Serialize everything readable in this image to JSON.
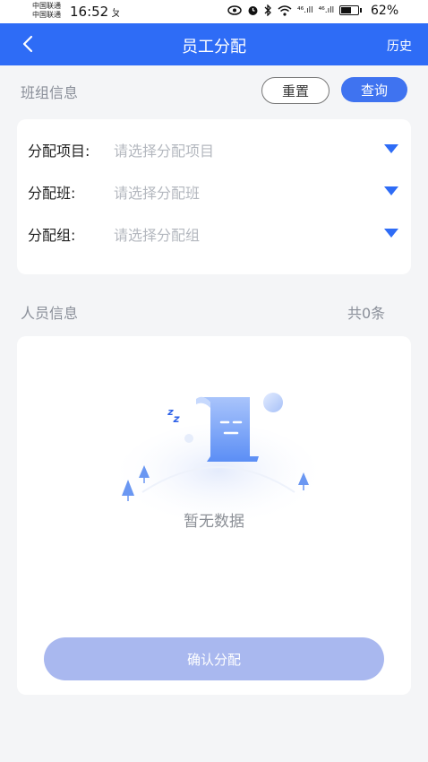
{
  "status_bar": {
    "carrier_1": "中国联通",
    "carrier_2": "中国联通",
    "time": "16:52",
    "notification_glyph": "ㄆ",
    "signal_1": "⁴⁶.ıll",
    "signal_2": "⁴⁶.ıll",
    "battery_level": 0.62,
    "battery_text": "62%"
  },
  "header": {
    "title": "员工分配",
    "history_label": "历史"
  },
  "team_section": {
    "label": "班组信息",
    "reset_label": "重置",
    "query_label": "查询"
  },
  "form": {
    "rows": [
      {
        "label": "分配项目:",
        "placeholder": "请选择分配项目"
      },
      {
        "label": "分配班:",
        "placeholder": "请选择分配班"
      },
      {
        "label": "分配组:",
        "placeholder": "请选择分配组"
      }
    ]
  },
  "staff_section": {
    "label": "人员信息",
    "count_text": "共0条",
    "empty_text": "暂无数据",
    "confirm_label": "确认分配"
  },
  "colors": {
    "primary": "#2e6cf6",
    "page_bg": "#f4f5f7",
    "confirm_disabled": "#a9b8ef"
  }
}
